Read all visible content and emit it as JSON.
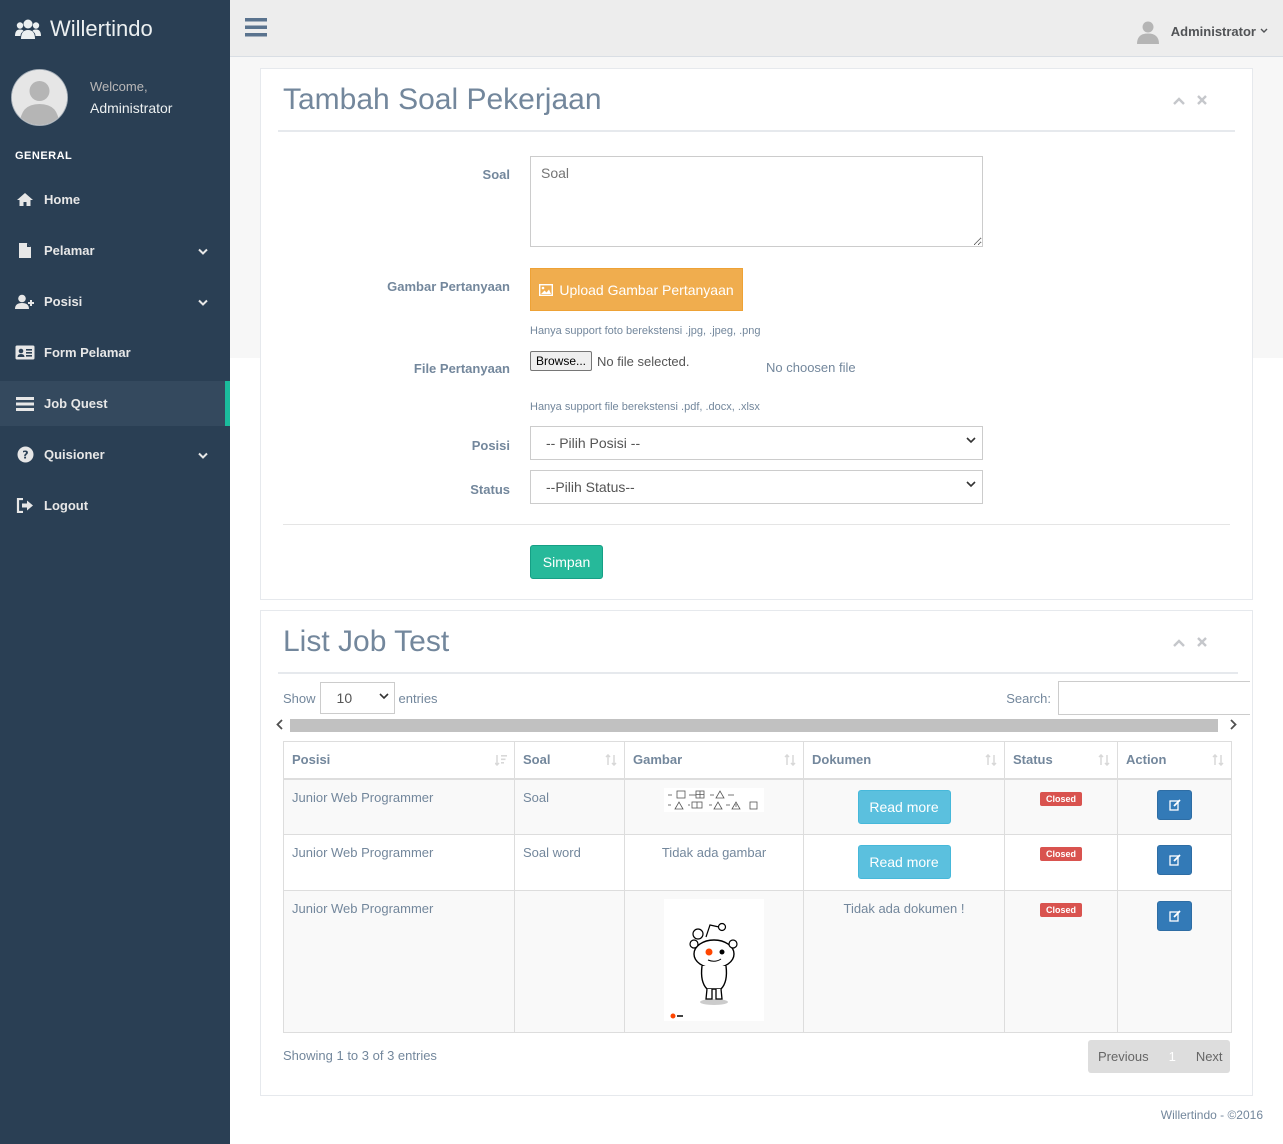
{
  "brand": {
    "name": "Willertindo"
  },
  "profile": {
    "welcome": "Welcome,",
    "name": "Administrator"
  },
  "sidebar": {
    "section": "GENERAL",
    "items": [
      {
        "label": "Home",
        "icon": "home-icon"
      },
      {
        "label": "Pelamar",
        "icon": "file-icon"
      },
      {
        "label": "Posisi",
        "icon": "user-plus-icon"
      },
      {
        "label": "Form Pelamar",
        "icon": "id-card-icon"
      },
      {
        "label": "Job Quest",
        "icon": "list-icon"
      },
      {
        "label": "Quisioner",
        "icon": "question-icon"
      },
      {
        "label": "Logout",
        "icon": "sign-out-icon"
      }
    ]
  },
  "topnav": {
    "user": "Administrator"
  },
  "form_panel": {
    "title": "Tambah Soal Pekerjaan",
    "soal_label": "Soal",
    "soal_placeholder": "Soal",
    "gambar_label": "Gambar Pertanyaan",
    "upload_button": "Upload Gambar Pertanyaan",
    "gambar_hint": "Hanya support foto berekstensi .jpg, .jpeg, .png",
    "file_label": "File Pertanyaan",
    "browse_button": "Browse...",
    "file_status": "No file selected.",
    "no_file_text": "No choosen file",
    "file_hint": "Hanya support file berekstensi .pdf, .docx, .xlsx",
    "posisi_label": "Posisi",
    "posisi_value": "-- Pilih Posisi --",
    "status_label": "Status",
    "status_value": "--Pilih Status--",
    "save_button": "Simpan"
  },
  "list_panel": {
    "title": "List Job Test",
    "show_label": "Show",
    "entries_value": "10",
    "entries_label": "entries",
    "search_label": "Search:",
    "columns": [
      "Posisi",
      "Soal",
      "Gambar",
      "Dokumen",
      "Status",
      "Action"
    ],
    "rows": [
      {
        "posisi": "Junior Web Programmer",
        "soal": "Soal",
        "gambar": "image",
        "dokumen": "Read more",
        "status": "Closed"
      },
      {
        "posisi": "Junior Web Programmer",
        "soal": "Soal word",
        "gambar": "Tidak ada gambar",
        "dokumen": "Read more",
        "status": "Closed"
      },
      {
        "posisi": "Junior Web Programmer",
        "soal": "",
        "gambar": "image",
        "dokumen": "Tidak ada dokumen !",
        "status": "Closed"
      }
    ],
    "info": "Showing 1 to 3 of 3 entries",
    "pager": {
      "previous": "Previous",
      "page": "1",
      "next": "Next"
    }
  },
  "footer": "Willertindo - ©2016",
  "colors": {
    "sidebar": "#2A3F54",
    "accent": "#1ABB9C",
    "warning": "#F0AD4E",
    "info": "#5BC0DE",
    "danger": "#D9534F",
    "primary": "#337AB7"
  }
}
